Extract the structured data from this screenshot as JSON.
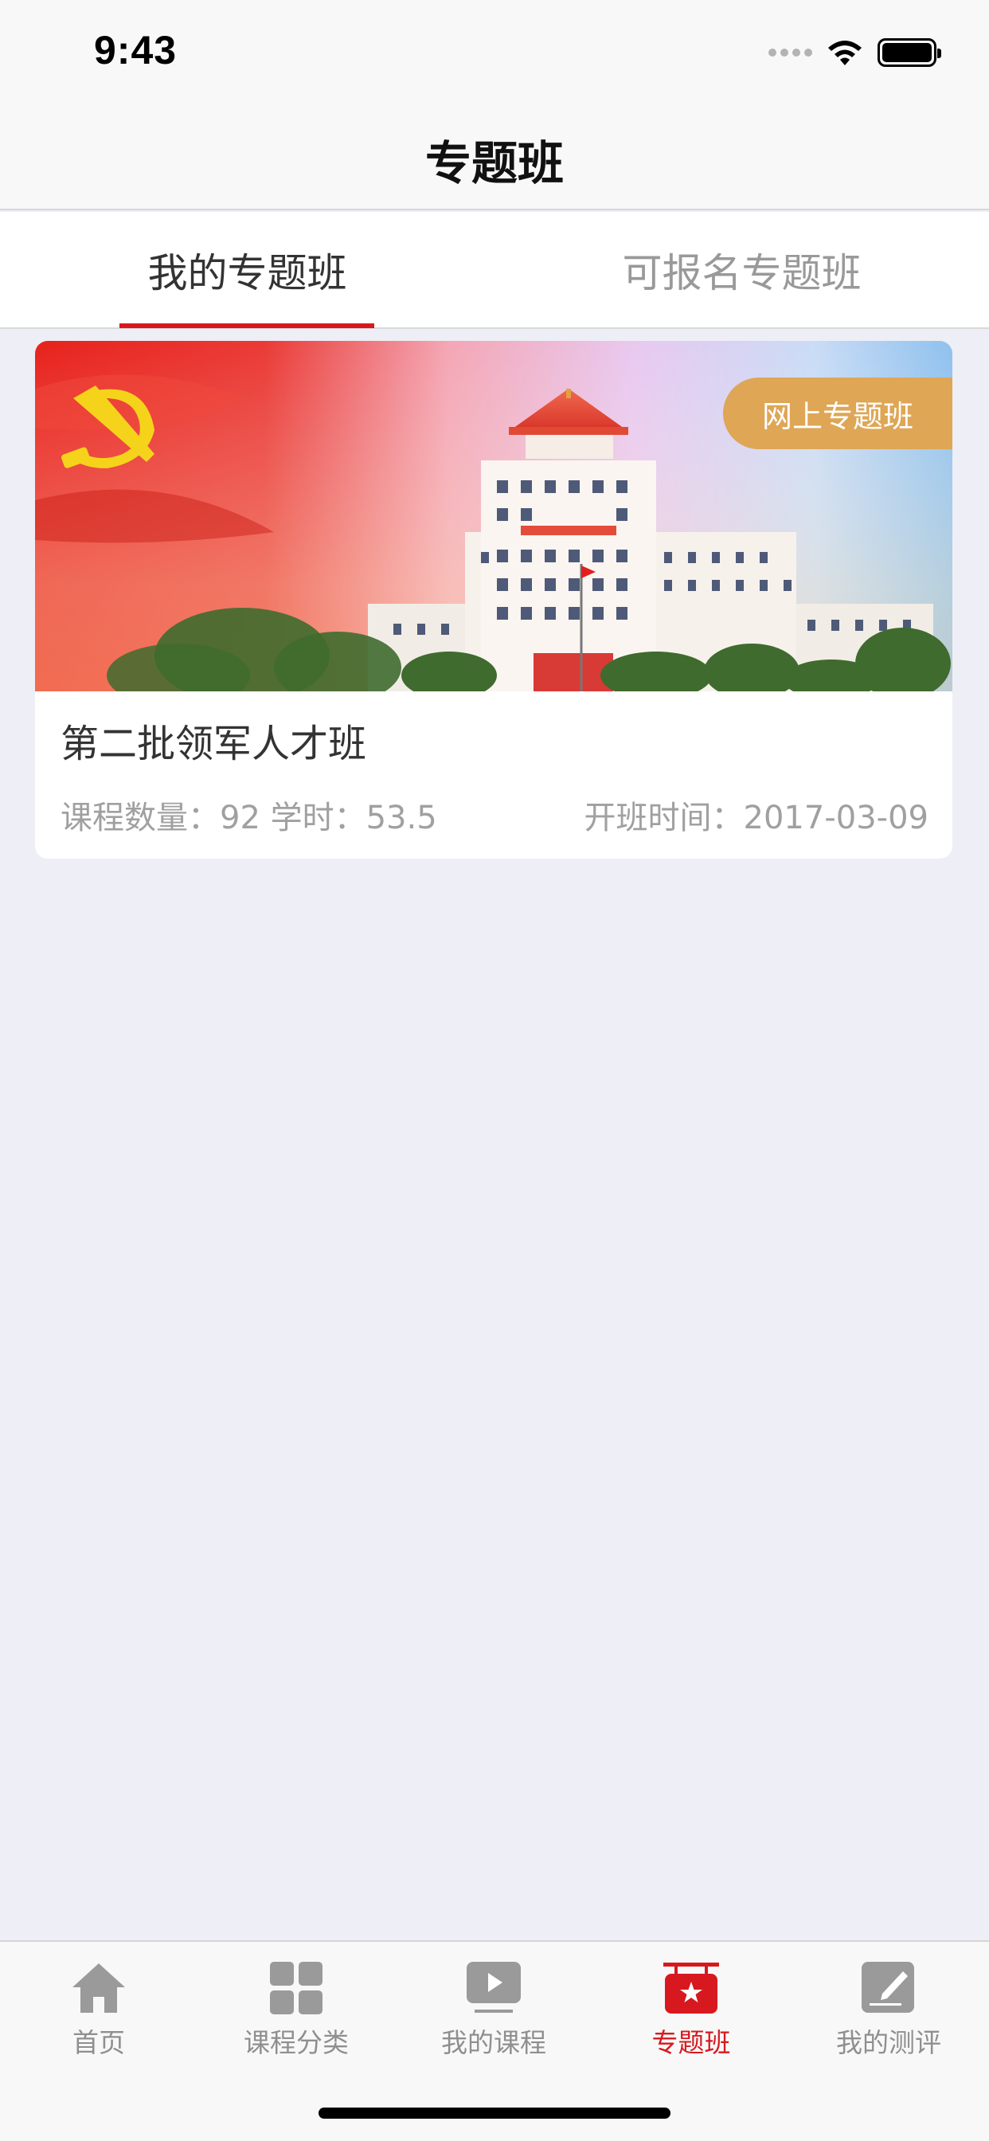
{
  "status_bar": {
    "time": "9:43"
  },
  "nav": {
    "title": "专题班"
  },
  "tabs": [
    {
      "label": "我的专题班",
      "active": true
    },
    {
      "label": "可报名专题班",
      "active": false
    }
  ],
  "card": {
    "tag": "网上专题班",
    "title": "第二批领军人才班",
    "meta_left": "课程数量：92 学时：53.5",
    "meta_right": "开班时间：2017-03-09"
  },
  "tab_bar": [
    {
      "label": "首页",
      "icon": "home-icon"
    },
    {
      "label": "课程分类",
      "icon": "grid-icon"
    },
    {
      "label": "我的课程",
      "icon": "play-icon"
    },
    {
      "label": "专题班",
      "icon": "special-class-icon",
      "active": true
    },
    {
      "label": "我的测评",
      "icon": "assessment-icon"
    }
  ],
  "colors": {
    "accent": "#d7191f",
    "tag": "#dea655",
    "background": "#eeeef6"
  }
}
